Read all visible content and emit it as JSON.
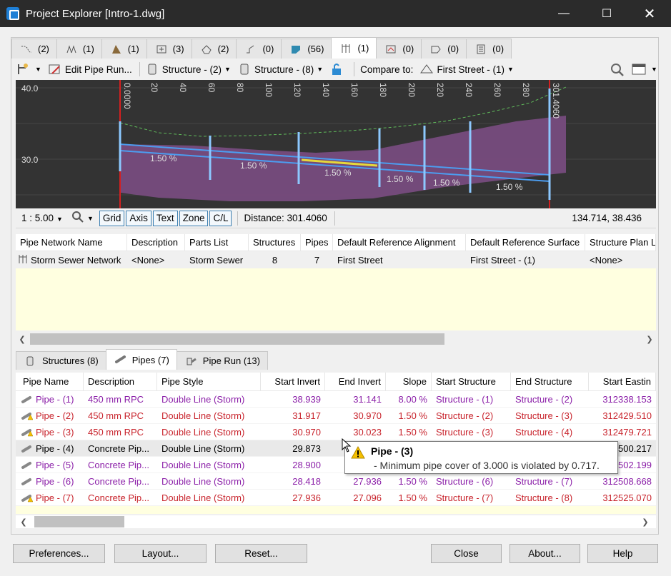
{
  "window": {
    "title": "Project Explorer [Intro-1.dwg]"
  },
  "top_tabs": [
    {
      "label": "(2)",
      "icon": "alignment-icon"
    },
    {
      "label": "(1)",
      "icon": "site-icon"
    },
    {
      "label": "(1)",
      "icon": "corridor-icon"
    },
    {
      "label": "(3)",
      "icon": "assembly-icon"
    },
    {
      "label": "(2)",
      "icon": "surface-icon"
    },
    {
      "label": "(0)",
      "icon": "feature-line-icon"
    },
    {
      "label": "(56)",
      "icon": "point-icon"
    },
    {
      "label": "(1)",
      "icon": "pipe-network-icon",
      "active": true
    },
    {
      "label": "(0)",
      "icon": "section-icon"
    },
    {
      "label": "(0)",
      "icon": "parcel-icon"
    },
    {
      "label": "(0)",
      "icon": "sheet-icon"
    }
  ],
  "toolbar": {
    "edit_pipe_run": "Edit Pipe Run...",
    "structure_a": "Structure - (2)",
    "structure_b": "Structure - (8)",
    "compare_to": "Compare to:",
    "compare_value": "First Street - (1)"
  },
  "profile": {
    "y_labels": [
      "40.0",
      "30.0"
    ],
    "stations": [
      "0.0000",
      "20",
      "40",
      "60",
      "80",
      "100",
      "120",
      "140",
      "160",
      "180",
      "200",
      "220",
      "240",
      "260",
      "280",
      "301.4060"
    ],
    "slopes": [
      "1.50 %",
      "1.50 %",
      "1.50 %",
      "1.50 %",
      "1.50 %",
      "1.50 %"
    ]
  },
  "profile_bar": {
    "scale": "1 : 5.00",
    "grid": "Grid",
    "axis": "Axis",
    "text": "Text",
    "zone": "Zone",
    "cl": "C/L",
    "distance": "Distance: 301.4060",
    "coords": "134.714, 38.436"
  },
  "network_grid": {
    "headers": [
      "Pipe Network Name",
      "Description",
      "Parts List",
      "Structures",
      "Pipes",
      "Default Reference Alignment",
      "Default Reference Surface",
      "Structure Plan L"
    ],
    "row": [
      "Storm Sewer Network",
      "<None>",
      "Storm Sewer",
      "8",
      "7",
      "First Street",
      "First Street - (1)",
      "<None>"
    ]
  },
  "mid_tabs": [
    {
      "label": "Structures (8)",
      "icon": "structure-icon"
    },
    {
      "label": "Pipes (7)",
      "icon": "pipe-icon",
      "active": true
    },
    {
      "label": "Pipe Run (13)",
      "icon": "pipe-run-icon"
    }
  ],
  "pipes_grid": {
    "headers": [
      "Pipe Name",
      "Description",
      "Pipe Style",
      "Start Invert",
      "End Invert",
      "Slope",
      "Start Structure",
      "End Structure",
      "Start Eastin"
    ],
    "rows": [
      {
        "name": "Pipe - (1)",
        "desc": "450 mm RPC",
        "style": "Double Line (Storm)",
        "start": "38.939",
        "end": "31.141",
        "slope": "8.00 %",
        "ss": "Structure - (1)",
        "es": "Structure - (2)",
        "east": "312338.153",
        "color": "purple",
        "warn": false
      },
      {
        "name": "Pipe - (2)",
        "desc": "450 mm RPC",
        "style": "Double Line (Storm)",
        "start": "31.917",
        "end": "30.970",
        "slope": "1.50 %",
        "ss": "Structure - (2)",
        "es": "Structure - (3)",
        "east": "312429.510",
        "color": "red",
        "warn": true
      },
      {
        "name": "Pipe - (3)",
        "desc": "450 mm RPC",
        "style": "Double Line (Storm)",
        "start": "30.970",
        "end": "30.023",
        "slope": "1.50 %",
        "ss": "Structure - (3)",
        "es": "Structure - (4)",
        "east": "312479.721",
        "color": "red",
        "warn": true
      },
      {
        "name": "Pipe - (4)",
        "desc": "Concrete Pip...",
        "style": "Double Line (Storm)",
        "start": "29.873",
        "end": "",
        "slope": "",
        "ss": "",
        "es": "",
        "east": "500.217",
        "color": "black",
        "warn": false,
        "selected": true
      },
      {
        "name": "Pipe - (5)",
        "desc": "Concrete Pip...",
        "style": "Double Line (Storm)",
        "start": "28.900",
        "end": "",
        "slope": "",
        "ss": "",
        "es": "",
        "east": "502.199",
        "color": "purple",
        "warn": false
      },
      {
        "name": "Pipe - (6)",
        "desc": "Concrete Pip...",
        "style": "Double Line (Storm)",
        "start": "28.418",
        "end": "27.936",
        "slope": "1.50 %",
        "ss": "Structure - (6)",
        "es": "Structure - (7)",
        "east": "312508.668",
        "color": "purple",
        "warn": false
      },
      {
        "name": "Pipe - (7)",
        "desc": "Concrete Pip...",
        "style": "Double Line (Storm)",
        "start": "27.936",
        "end": "27.096",
        "slope": "1.50 %",
        "ss": "Structure - (7)",
        "es": "Structure - (8)",
        "east": "312525.070",
        "color": "red",
        "warn": true
      }
    ]
  },
  "tooltip": {
    "title": "Pipe - (3)",
    "message": "- Minimum pipe cover of 3.000 is violated by 0.717."
  },
  "buttons": {
    "preferences": "Preferences...",
    "layout": "Layout...",
    "reset": "Reset...",
    "close": "Close",
    "about": "About...",
    "help": "Help"
  }
}
